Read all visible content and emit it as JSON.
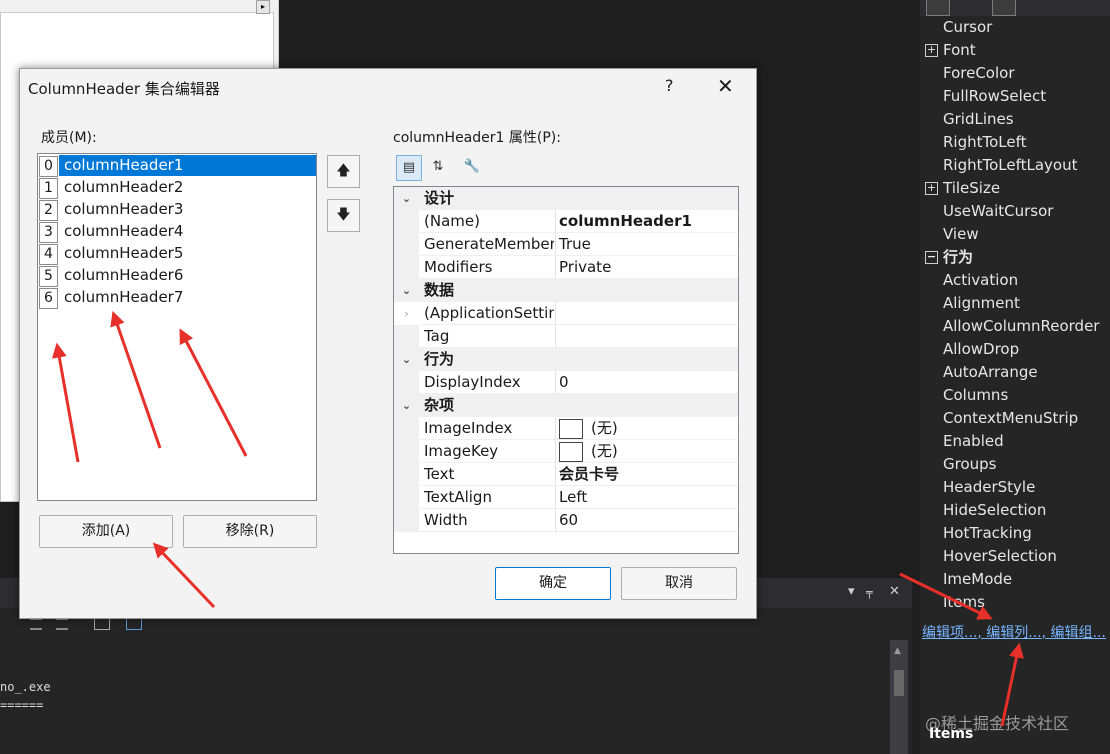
{
  "dialog": {
    "title": "ColumnHeader 集合编辑器",
    "help": "?",
    "close": "✕",
    "members_label": "成员(M):",
    "props_label": "columnHeader1 属性(P):",
    "members": [
      {
        "index": "0",
        "name": "columnHeader1"
      },
      {
        "index": "1",
        "name": "columnHeader2"
      },
      {
        "index": "2",
        "name": "columnHeader3"
      },
      {
        "index": "3",
        "name": "columnHeader4"
      },
      {
        "index": "4",
        "name": "columnHeader5"
      },
      {
        "index": "5",
        "name": "columnHeader6"
      },
      {
        "index": "6",
        "name": "columnHeader7"
      }
    ],
    "up_arrow": "🡅",
    "down_arrow": "🡇",
    "add_button": "添加(A)",
    "remove_button": "移除(R)",
    "ok_button": "确定",
    "cancel_button": "取消",
    "grid": {
      "cat_design": "设计",
      "name_label": "(Name)",
      "name_value": "columnHeader1",
      "generate_label": "GenerateMember",
      "generate_value": "True",
      "modifiers_label": "Modifiers",
      "modifiers_value": "Private",
      "cat_data": "数据",
      "appsettings_label": "(ApplicationSettin",
      "tag_label": "Tag",
      "cat_behavior": "行为",
      "displayindex_label": "DisplayIndex",
      "displayindex_value": "0",
      "cat_misc": "杂项",
      "imageindex_label": "ImageIndex",
      "imageindex_value": "(无)",
      "imagekey_label": "ImageKey",
      "imagekey_value": "(无)",
      "text_label": "Text",
      "text_value": "会员卡号",
      "textalign_label": "TextAlign",
      "textalign_value": "Left",
      "width_label": "Width",
      "width_value": "60"
    }
  },
  "properties_panel": {
    "rows": [
      {
        "name": "Cursor",
        "expander": ""
      },
      {
        "name": "Font",
        "expander": "+"
      },
      {
        "name": "ForeColor",
        "expander": ""
      },
      {
        "name": "FullRowSelect",
        "expander": ""
      },
      {
        "name": "GridLines",
        "expander": ""
      },
      {
        "name": "RightToLeft",
        "expander": ""
      },
      {
        "name": "RightToLeftLayout",
        "expander": ""
      },
      {
        "name": "TileSize",
        "expander": "+"
      },
      {
        "name": "UseWaitCursor",
        "expander": ""
      },
      {
        "name": "View",
        "expander": ""
      },
      {
        "name": "行为",
        "expander": "−"
      },
      {
        "name": "Activation",
        "expander": ""
      },
      {
        "name": "Alignment",
        "expander": ""
      },
      {
        "name": "AllowColumnReorder",
        "expander": ""
      },
      {
        "name": "AllowDrop",
        "expander": ""
      },
      {
        "name": "AutoArrange",
        "expander": ""
      },
      {
        "name": "Columns",
        "expander": ""
      },
      {
        "name": "ContextMenuStrip",
        "expander": ""
      },
      {
        "name": "Enabled",
        "expander": ""
      },
      {
        "name": "Groups",
        "expander": ""
      },
      {
        "name": "HeaderStyle",
        "expander": ""
      },
      {
        "name": "HideSelection",
        "expander": ""
      },
      {
        "name": "HotTracking",
        "expander": ""
      },
      {
        "name": "HoverSelection",
        "expander": ""
      },
      {
        "name": "ImeMode",
        "expander": ""
      },
      {
        "name": "Items",
        "expander": ""
      }
    ],
    "link_edit_items": "编辑项...",
    "link_edit_columns": "编辑列...",
    "link_edit_groups": "编辑组...",
    "desc_title": "Items",
    "watermark": "@稀土掘金技术社区"
  },
  "output_panel": {
    "line1": "no_.exe",
    "line2": "======",
    "dropdown": "▾",
    "pin": "📌",
    "close": "✕"
  },
  "colors": {
    "selection": "#0078d7",
    "link": "#78b5ff",
    "annotation_arrow": "#e8302a"
  }
}
